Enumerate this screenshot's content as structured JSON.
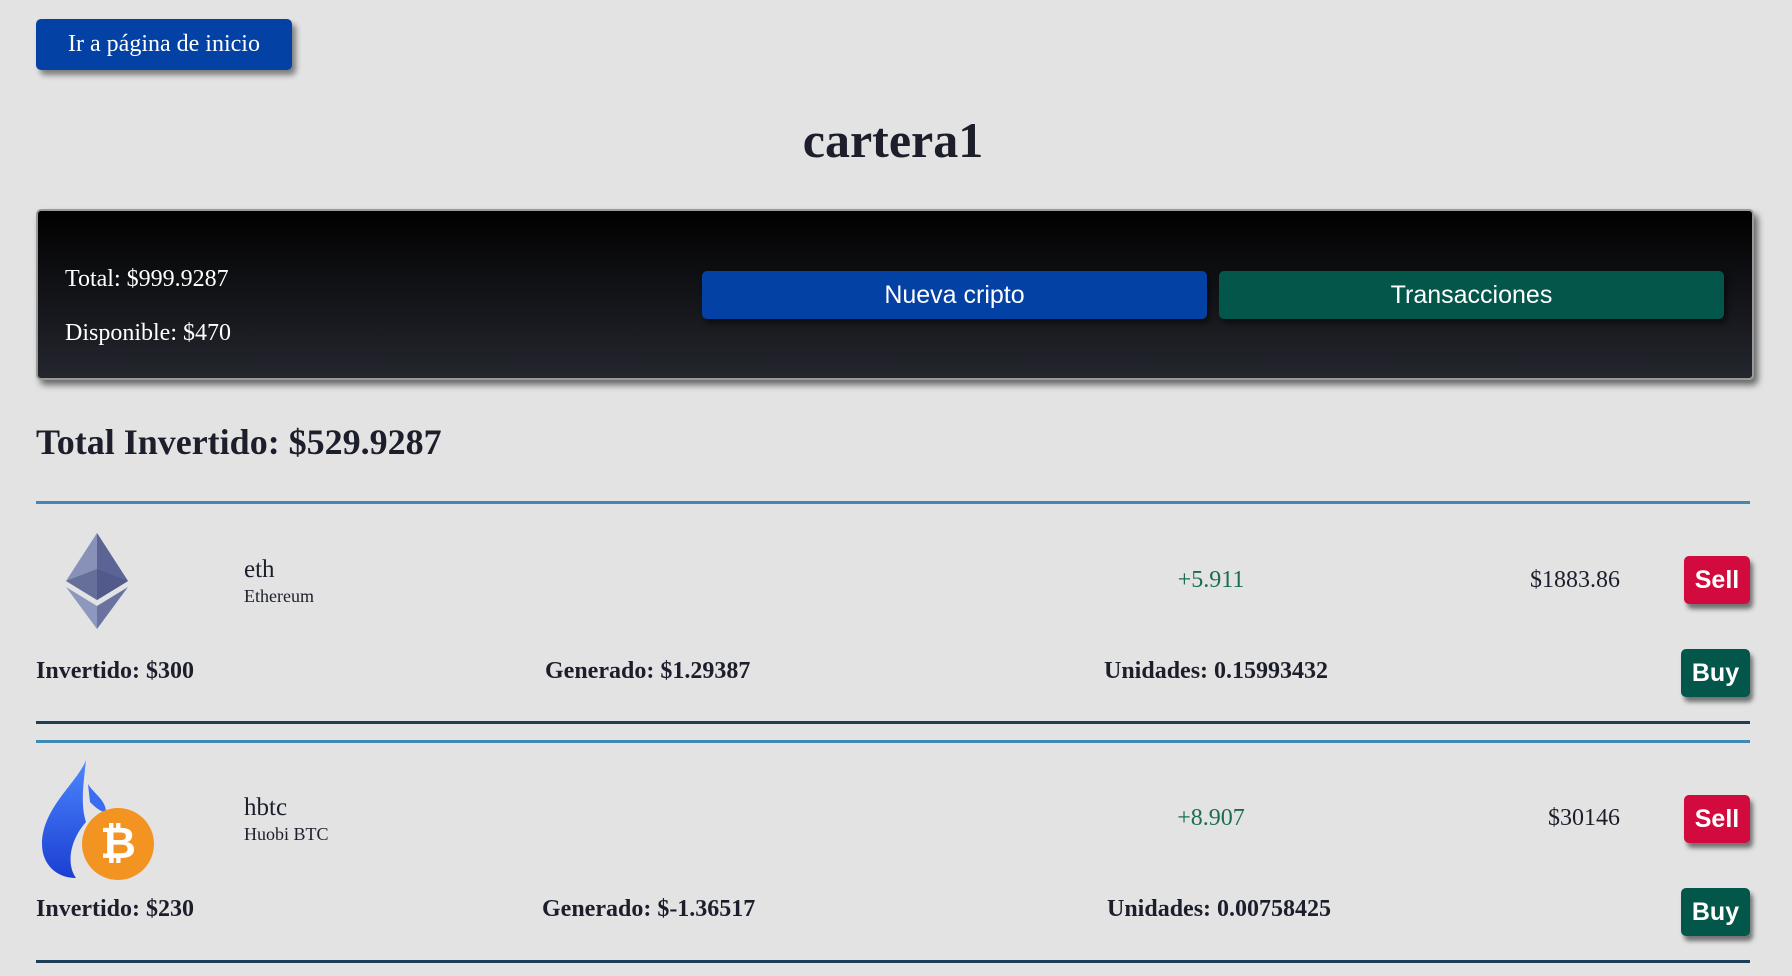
{
  "nav": {
    "home_label": "Ir a página de inicio"
  },
  "portfolio": {
    "title": "cartera1",
    "total_text": "Total: $999.9287",
    "available_text": "Disponible: $470",
    "new_crypto_label": "Nueva cripto",
    "transactions_label": "Transacciones",
    "total_invested_text": "Total Invertido: $529.9287"
  },
  "assets": [
    {
      "symbol": "eth",
      "name": "Ethereum",
      "change": "+5.911",
      "price": "$1883.86",
      "invested": "Invertido: $300",
      "generated": "Generado: $1.29387",
      "units": "Unidades: 0.15993432",
      "sell_label": "Sell",
      "buy_label": "Buy",
      "icon": "ethereum-logo-icon"
    },
    {
      "symbol": "hbtc",
      "name": "Huobi BTC",
      "change": "+8.907",
      "price": "$30146",
      "invested": "Invertido: $230",
      "generated": "Generado: $-1.36517",
      "units": "Unidades: 0.00758425",
      "sell_label": "Sell",
      "buy_label": "Buy",
      "icon": "huobi-btc-logo-icon"
    }
  ],
  "colors": {
    "background": "#e3e3e3",
    "primary_blue": "#0441a4",
    "primary_green": "#03574a",
    "sell_red": "#d20a3e",
    "change_green": "#1b6c55",
    "divider_top": "#3f88b3",
    "divider_bottom": "#1c3f55"
  }
}
